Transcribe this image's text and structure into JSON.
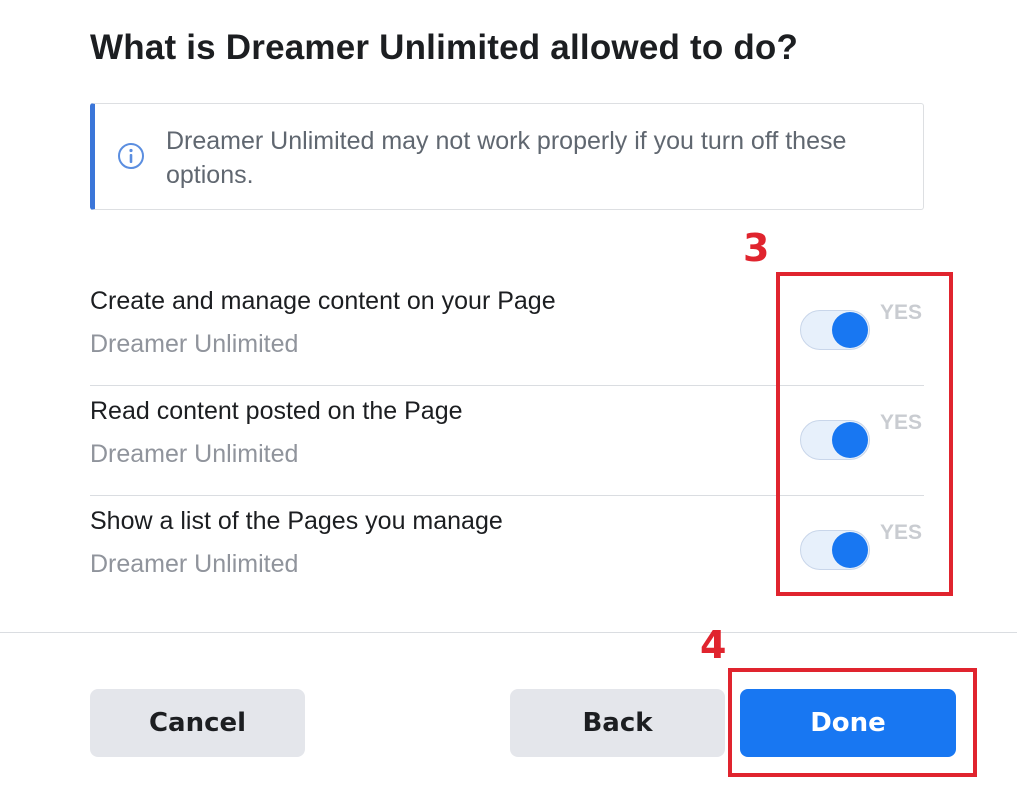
{
  "dialog": {
    "title": "What is Dreamer Unlimited allowed to do?",
    "notice": {
      "icon": "info-icon",
      "text": "Dreamer Unlimited may not work properly if you turn off these options.",
      "accent_color": "#3b76d9"
    }
  },
  "permissions": [
    {
      "title": "Create and manage content on your Page",
      "subtitle": "Dreamer Unlimited",
      "enabled": true,
      "toggle_label": "YES"
    },
    {
      "title": "Read content posted on the Page",
      "subtitle": "Dreamer Unlimited",
      "enabled": true,
      "toggle_label": "YES"
    },
    {
      "title": "Show a list of the Pages you manage",
      "subtitle": "Dreamer Unlimited",
      "enabled": true,
      "toggle_label": "YES"
    }
  ],
  "annotations": {
    "step_3": "3",
    "step_4": "4",
    "color": "#e0242e"
  },
  "footer": {
    "cancel_label": "Cancel",
    "back_label": "Back",
    "done_label": "Done"
  },
  "colors": {
    "primary": "#1877f2",
    "secondary_button": "#e4e6eb"
  }
}
